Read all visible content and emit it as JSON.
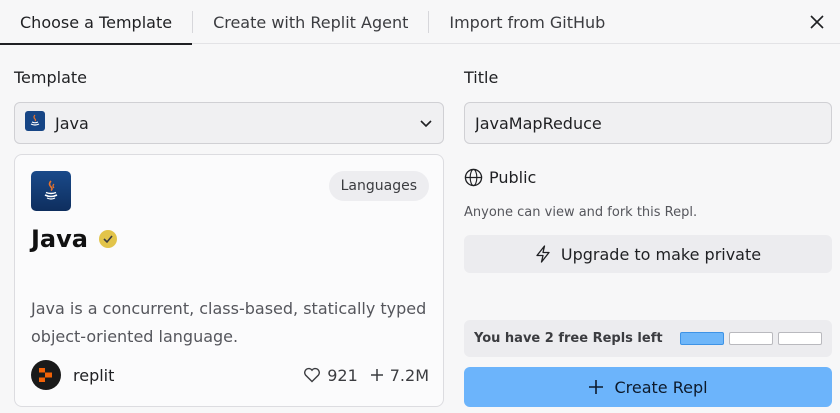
{
  "tabs": [
    {
      "label": "Choose a Template"
    },
    {
      "label": "Create with Replit Agent"
    },
    {
      "label": "Import from GitHub"
    }
  ],
  "template": {
    "label": "Template",
    "selected": "Java"
  },
  "card": {
    "badge": "Languages",
    "name": "Java",
    "description": "Java is a concurrent, class-based, statically typed object-oriented language.",
    "author": "replit",
    "likes": "921",
    "forks": "7.2M"
  },
  "title": {
    "label": "Title",
    "value": "JavaMapReduce"
  },
  "visibility": {
    "label": "Public",
    "note": "Anyone can view and fork this Repl."
  },
  "upgrade": {
    "label": "Upgrade to make private"
  },
  "quota": {
    "text": "You have 2 free Repls left",
    "used": 1,
    "total": 3
  },
  "create": {
    "label": "Create Repl"
  },
  "colors": {
    "accent": "#6cb4fb",
    "verified": "#e2c44a"
  },
  "icons": [
    "java-icon",
    "chevron-down-icon",
    "close-icon",
    "verified-icon",
    "heart-icon",
    "plus-icon",
    "globe-icon",
    "bolt-icon",
    "replit-logo-icon"
  ]
}
